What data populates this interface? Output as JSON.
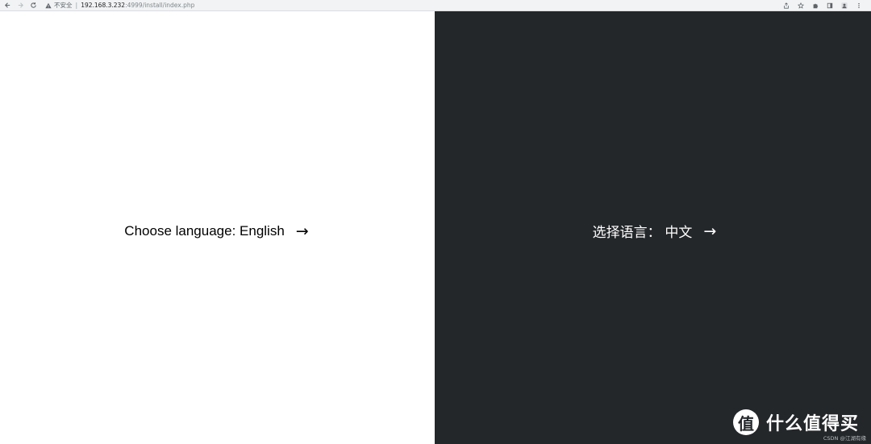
{
  "browser": {
    "security_label": "不安全",
    "separator": "|",
    "url_host": "192.168.3.232",
    "url_path": ":4999/install/index.php"
  },
  "panels": {
    "english": {
      "label": "Choose language: English",
      "arrow": "→",
      "background": "#ffffff"
    },
    "chinese": {
      "label": "选择语言： 中文",
      "arrow": "→",
      "background": "#24272a"
    }
  },
  "watermark": {
    "logo_glyph": "值",
    "text": "什么值得买",
    "credit": "CSDN @江湖有缘"
  }
}
